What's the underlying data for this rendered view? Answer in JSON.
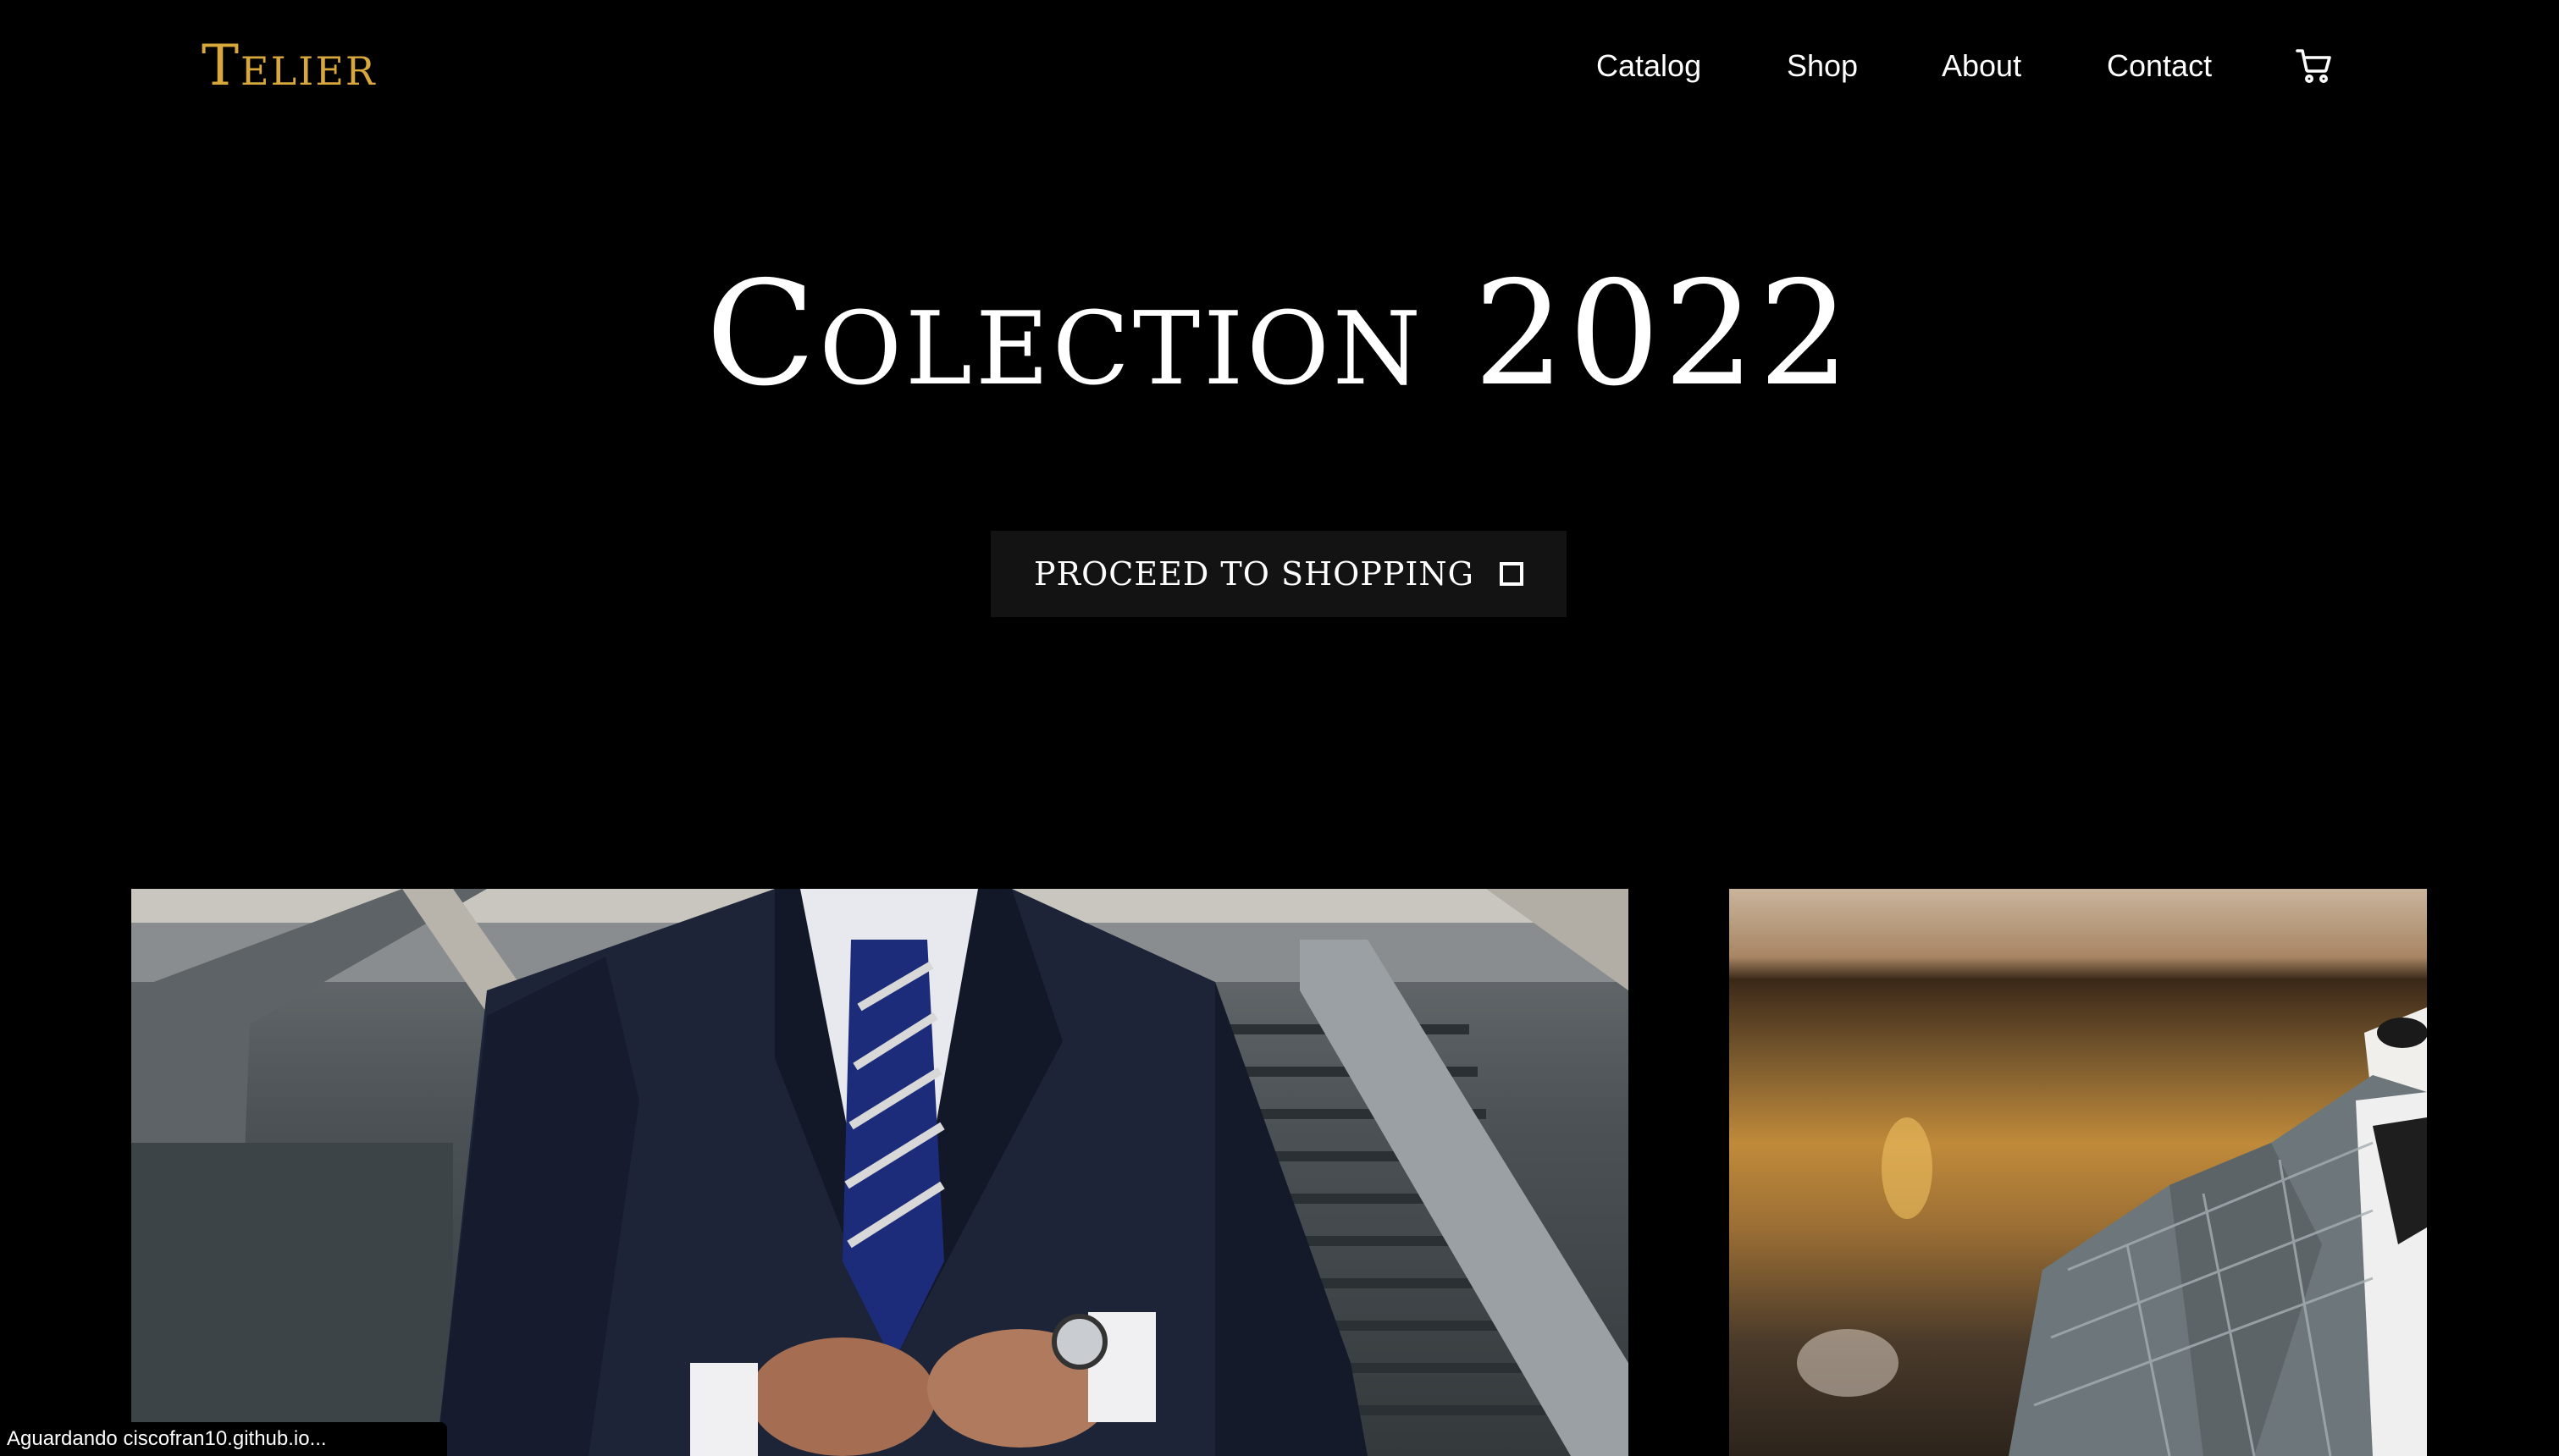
{
  "header": {
    "brand": "Telier",
    "nav": [
      {
        "label": "Catalog"
      },
      {
        "label": "Shop"
      },
      {
        "label": "About"
      },
      {
        "label": "Contact"
      }
    ],
    "cart_icon": "shopping-cart-icon"
  },
  "hero": {
    "title": "Colection 2022",
    "cta_label": "PROCEED TO SHOPPING",
    "cta_icon": "square-outline-icon"
  },
  "gallery": {
    "images": [
      {
        "name": "businessman-suit-photo"
      },
      {
        "name": "suit-mannequin-photo"
      }
    ]
  },
  "status_bar": {
    "text": "Aguardando ciscofran10.github.io..."
  },
  "colors": {
    "background": "#000000",
    "brand": "#d9a83c",
    "text": "#ffffff",
    "button_bg": "#131313"
  }
}
